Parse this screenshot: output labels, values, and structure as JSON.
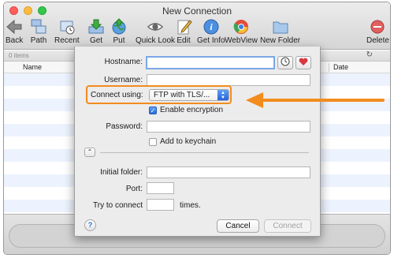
{
  "window": {
    "title": "New Connection"
  },
  "toolbar": {
    "items": [
      {
        "label": "Back",
        "icon": "back-arrow-icon"
      },
      {
        "label": "Path",
        "icon": "path-icon"
      },
      {
        "label": "Recent",
        "icon": "recent-icon"
      },
      {
        "label": "Get",
        "icon": "download-icon"
      },
      {
        "label": "Put",
        "icon": "upload-globe-icon"
      },
      {
        "label": "Quick Look",
        "icon": "eye-icon"
      },
      {
        "label": "Edit",
        "icon": "pencil-icon"
      },
      {
        "label": "Get Info",
        "icon": "info-icon"
      },
      {
        "label": "WebView",
        "icon": "chrome-icon"
      },
      {
        "label": "New Folder",
        "icon": "new-folder-icon"
      },
      {
        "label": "Delete",
        "icon": "delete-icon"
      }
    ]
  },
  "browser": {
    "items_count": "0 items",
    "columns": {
      "name": "Name",
      "date": "Date"
    }
  },
  "dialog": {
    "hostname_label": "Hostname:",
    "hostname_value": "",
    "username_label": "Username:",
    "username_value": "",
    "connect_label": "Connect using:",
    "connect_value": "FTP with TLS/...",
    "enable_encryption": "Enable encryption",
    "enable_encryption_checked": true,
    "password_label": "Password:",
    "password_value": "",
    "keychain_label": "Add to keychain",
    "keychain_checked": false,
    "initial_folder_label": "Initial folder:",
    "initial_folder_value": "",
    "port_label": "Port:",
    "port_value": "",
    "try_label": "Try to connect",
    "try_value": "",
    "times_label": "times.",
    "help_glyph": "?",
    "cancel_label": "Cancel",
    "connect_button_label": "Connect"
  },
  "colors": {
    "highlight_orange": "#f28c1e",
    "focus_blue": "#7aa7e4",
    "row_stripe": "#edf3fe"
  }
}
